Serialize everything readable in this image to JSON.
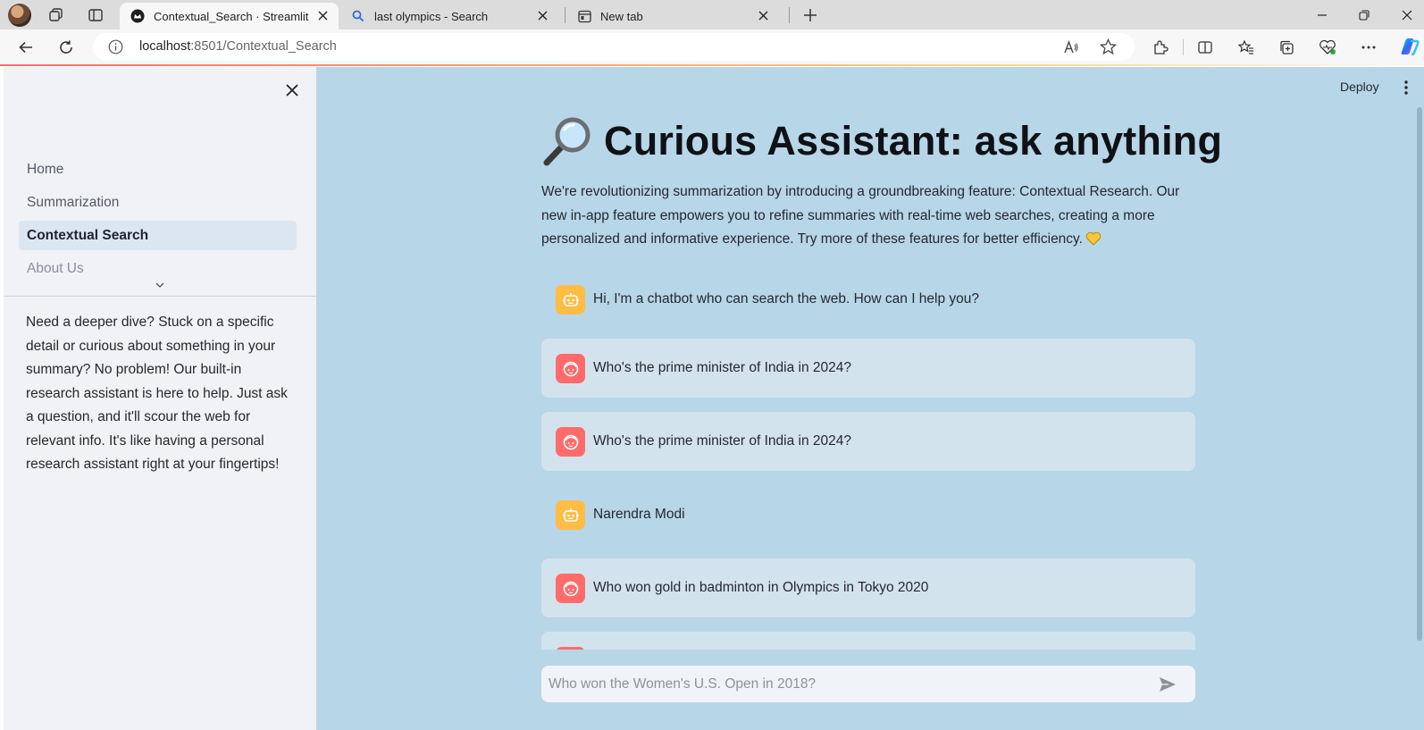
{
  "browser": {
    "tabs": [
      {
        "title": "Contextual_Search · Streamlit",
        "active": true,
        "favicon": "streamlit-crown-icon"
      },
      {
        "title": "last olympics - Search",
        "active": false,
        "favicon": "search-icon"
      },
      {
        "title": "New tab",
        "active": false,
        "favicon": "newtab-icon"
      }
    ],
    "url_host": "localhost",
    "url_rest": ":8501/Contextual_Search"
  },
  "sidebar": {
    "nav": [
      {
        "label": "Home"
      },
      {
        "label": "Summarization"
      },
      {
        "label": "Contextual Search",
        "active": true
      },
      {
        "label": "About Us"
      }
    ],
    "description": "Need a deeper dive? Stuck on a specific detail or curious about something in your summary? No problem! Our built-in research assistant is here to help. Just ask a question, and it'll scour the web for relevant info. It's like having a personal research assistant right at your fingertips!"
  },
  "header": {
    "deploy_label": "Deploy"
  },
  "main": {
    "title": "Curious Assistant: ask anything",
    "title_icon": "magnifying-glass-icon",
    "intro": "We're revolutionizing summarization by introducing a groundbreaking feature: Contextual Research. Our new in-app feature empowers you to refine summaries with real-time web searches, creating a more personalized and informative experience. Try more of these features for better efficiency.",
    "intro_emoji": "yellow-heart-icon",
    "messages": [
      {
        "role": "assistant",
        "text": "Hi, I'm a chatbot who can search the web. How can I help you?"
      },
      {
        "role": "user",
        "text": "Who's the prime minister of India in 2024?"
      },
      {
        "role": "user",
        "text": "Who's the prime minister of India in 2024?"
      },
      {
        "role": "assistant",
        "text": "Narendra Modi"
      },
      {
        "role": "user",
        "text": "Who won gold in badminton in Olympics in Tokyo 2020"
      },
      {
        "role": "user",
        "text": ""
      }
    ],
    "chat_input": {
      "placeholder": "Who won the Women's U.S. Open in 2018?"
    }
  },
  "colors": {
    "main_bg": "#b7d6e8",
    "sidebar_bg": "#f0f2f6",
    "user_bubble": "#d3e3ee",
    "bot_avatar": "#ffbd45",
    "user_avatar": "#ff6b6b"
  }
}
